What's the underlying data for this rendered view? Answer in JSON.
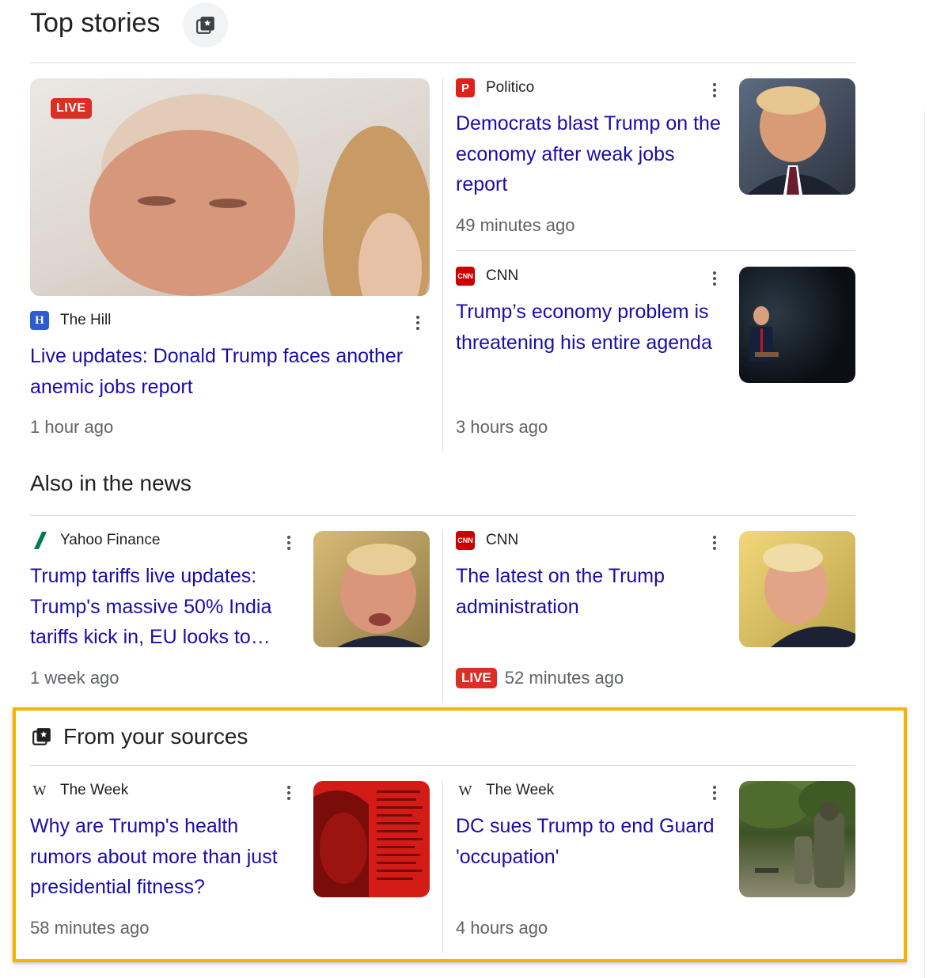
{
  "top_stories": {
    "heading": "Top stories",
    "icon": "sources-star-icon",
    "featured": {
      "live_label": "LIVE",
      "source": "The Hill",
      "title": "Live updates: Donald Trump faces another anemic jobs report",
      "time": "1 hour ago"
    },
    "story_1": {
      "source": "Politico",
      "title": "Democrats blast Trump on the economy after weak jobs report",
      "time": "49 minutes ago"
    },
    "story_2": {
      "source": "CNN",
      "title": "Trump’s economy problem is threatening his entire agenda",
      "time": "3 hours ago"
    }
  },
  "also_in_news": {
    "heading": "Also in the news",
    "story_1": {
      "source": "Yahoo Finance",
      "title": "Trump tariffs live updates: Trump's massive 50% India tariffs kick in, EU looks to…",
      "time": "1 week ago"
    },
    "story_2": {
      "source": "CNN",
      "title": "The latest on the Trump administration",
      "live_label": "LIVE",
      "time": "52 minutes ago"
    }
  },
  "from_sources": {
    "heading": "From your sources",
    "highlight_color": "#f4b400",
    "story_1": {
      "source": "The Week",
      "title": "Why are Trump's health rumors about more than just presidential fitness?",
      "time": "58 minutes ago"
    },
    "story_2": {
      "source": "The Week",
      "title": "DC sues Trump to end Guard 'occupation'",
      "time": "4 hours ago"
    }
  },
  "colors": {
    "link": "#1a0dab",
    "live_badge": "#d93025",
    "politico": "#e0201b",
    "cnn": "#cc0000",
    "the_hill": "#2c5bd3",
    "yahoo_finance": "#007b55"
  }
}
